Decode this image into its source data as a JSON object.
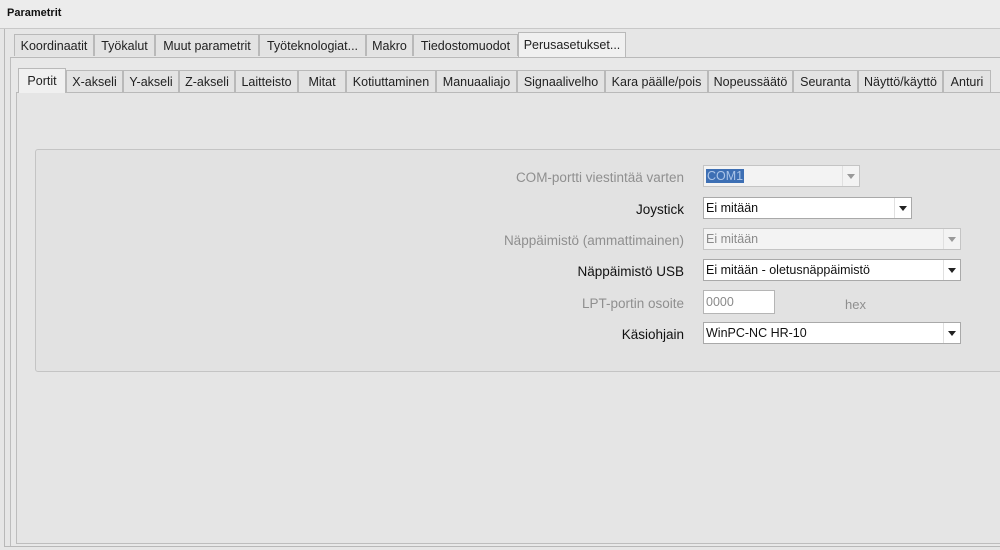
{
  "window": {
    "title": "Parametrit"
  },
  "outer_tabs": [
    "Koordinaatit",
    "Työkalut",
    "Muut parametrit",
    "Työteknologiat...",
    "Makro",
    "Tiedostomuodot",
    "Perusasetukset..."
  ],
  "outer_active": "Perusasetukset...",
  "inner_tabs": [
    "Portit",
    "X-akseli",
    "Y-akseli",
    "Z-akseli",
    "Laitteisto",
    "Mitat",
    "Kotiuttaminen",
    "Manuaaliajo",
    "Signaalivelho",
    "Kara päälle/pois",
    "Nopeussäätö",
    "Seuranta",
    "Näyttö/käyttö",
    "Anturi"
  ],
  "inner_active": "Portit",
  "form": {
    "com_label": "COM-portti viestintää varten",
    "com_value": "COM1",
    "joystick_label": "Joystick",
    "joystick_value": "Ei mitään",
    "keyboard_pro_label": "Näppäimistö (ammattimainen)",
    "keyboard_pro_value": "Ei mitään",
    "keyboard_usb_label": "Näppäimistö USB",
    "keyboard_usb_value": "Ei mitään - oletusnäppäimistö",
    "lpt_label": "LPT-portin osoite",
    "lpt_value": "0000",
    "lpt_unit": "hex",
    "handwheel_label": "Käsiohjain",
    "handwheel_value": "WinPC-NC HR-10"
  }
}
